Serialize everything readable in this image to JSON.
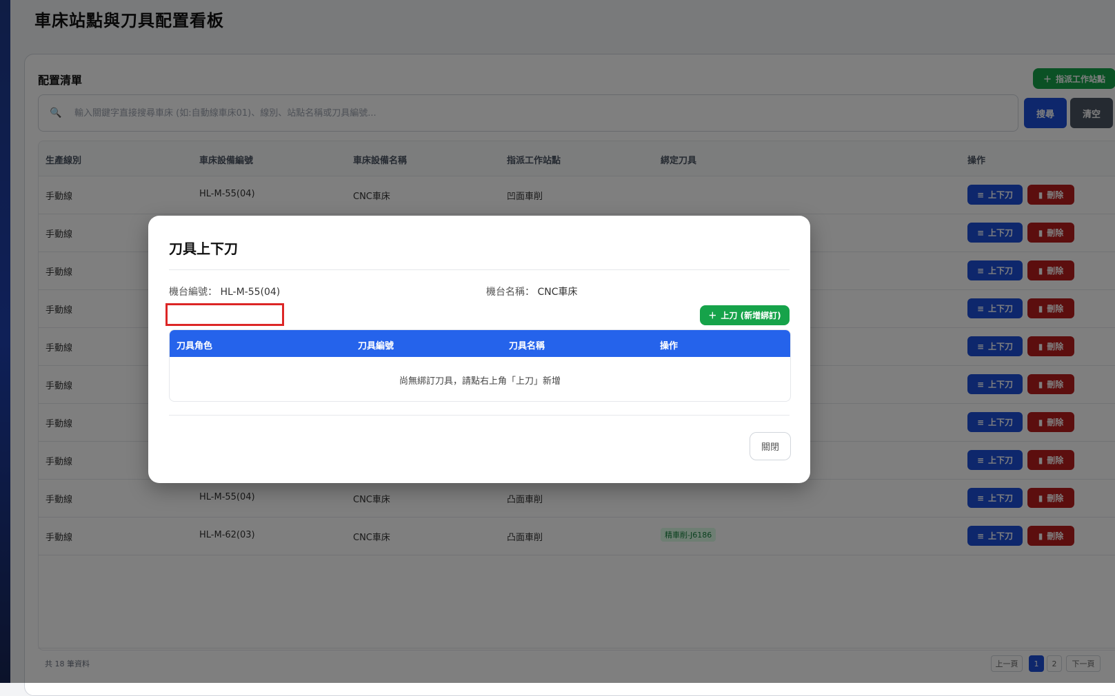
{
  "page": {
    "title": "車床站點與刀具配置看板"
  },
  "list": {
    "title": "配置清單",
    "assign_button": "指派工作站點",
    "search_placeholder": "輸入關鍵字直接搜尋車床 (如:自動線車床01)、線別、站點名稱或刀具編號...",
    "search_button": "搜尋",
    "clear_button": "清空"
  },
  "table": {
    "headers": [
      "生產線別",
      "車床設備編號",
      "車床設備名稱",
      "指派工作站點",
      "綁定刀具",
      "操作"
    ],
    "rows": [
      {
        "line": "手動線",
        "id": "HL-M-55(04)",
        "name": "CNC車床",
        "station": "凹面車削",
        "tool": ""
      },
      {
        "line": "手動線",
        "id": "",
        "name": "",
        "station": "",
        "tool": ""
      },
      {
        "line": "手動線",
        "id": "",
        "name": "",
        "station": "",
        "tool": ""
      },
      {
        "line": "手動線",
        "id": "",
        "name": "",
        "station": "",
        "tool": ""
      },
      {
        "line": "手動線",
        "id": "",
        "name": "",
        "station": "",
        "tool": ""
      },
      {
        "line": "手動線",
        "id": "",
        "name": "",
        "station": "",
        "tool": ""
      },
      {
        "line": "手動線",
        "id": "",
        "name": "",
        "station": "",
        "tool": ""
      },
      {
        "line": "手動線",
        "id": "",
        "name": "",
        "station": "",
        "tool": ""
      },
      {
        "line": "手動線",
        "id": "HL-M-55(04)",
        "name": "CNC車床",
        "station": "凸面車削",
        "tool": ""
      },
      {
        "line": "手動線",
        "id": "HL-M-62(03)",
        "name": "CNC車床",
        "station": "凸面車削",
        "tool": "精車削-J6186"
      }
    ],
    "load_button": "上下刀",
    "delete_button": "刪除"
  },
  "footer": {
    "total": "共 18 筆資料",
    "prev": "上一頁",
    "pages": [
      "1",
      "2"
    ],
    "next": "下一頁"
  },
  "modal": {
    "title": "刀具上下刀",
    "machine_id_label": "機台編號：",
    "machine_id": "HL-M-55(04)",
    "machine_name_label": "機台名稱：",
    "machine_name": "CNC車床",
    "mount_button": "上刀 (新增綁訂)",
    "headers": [
      "刀具角色",
      "刀具編號",
      "刀具名稱",
      "操作"
    ],
    "empty_message": "尚無綁訂刀具，請點右上角「上刀」新增",
    "close_button": "關閉"
  }
}
